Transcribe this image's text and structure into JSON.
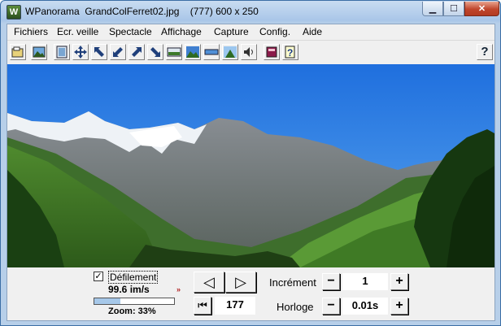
{
  "window": {
    "title": "WPanorama  GrandColFerret02.jpg    (777) 600 x 250",
    "app_icon_letter": "W",
    "controls": {
      "minimize": "▁",
      "maximize": "☐",
      "close": "✕"
    }
  },
  "menu": [
    "Fichiers",
    "Ecr. veille",
    "Spectacle",
    "Affichage",
    "Capture",
    "Config.",
    "Aide"
  ],
  "toolbar": {
    "icons": [
      "open-file-icon",
      "image-icon",
      "fit-window-icon",
      "move-all-icon",
      "arrow-up-left-icon",
      "arrow-down-left-icon",
      "arrow-up-right-icon",
      "arrow-down-right-icon",
      "panorama-icon",
      "landscape-icon",
      "strip-icon",
      "sky-gradient-icon",
      "speaker-icon",
      "book-icon",
      "help-file-icon",
      "help-icon"
    ],
    "help_label": "?"
  },
  "controls": {
    "scroll_label": "Défilement",
    "scroll_checked": true,
    "speed": "99.6 im/s",
    "zoom_label": "Zoom: 33%",
    "zoom_fraction": 0.33,
    "prev_glyph": "◁",
    "next_glyph": "▷",
    "first_glyph": "⏮",
    "frame_number": "177",
    "increment_label": "Incrément",
    "increment_value": "1",
    "clock_label": "Horloge",
    "clock_value": "0.01s",
    "minus": "−",
    "plus": "+"
  }
}
